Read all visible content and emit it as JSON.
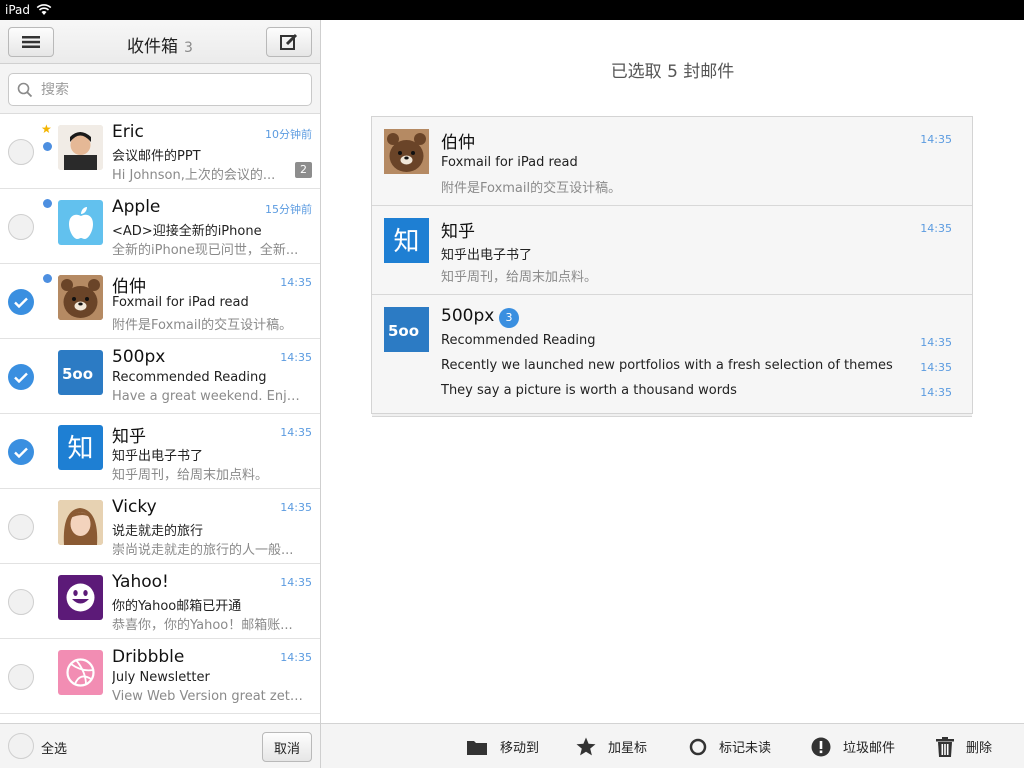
{
  "status_bar": {
    "device": "iPad"
  },
  "inbox": {
    "title": "收件箱",
    "count": "3",
    "search_placeholder": "搜索"
  },
  "messages": [
    {
      "name": "Eric",
      "time": "10分钟前",
      "subject": "会议邮件的PPT",
      "preview": "Hi Johnson,上次的会议的...",
      "badge": "2",
      "starred": true,
      "unread": true,
      "selected": false,
      "avatar": "person-eric"
    },
    {
      "name": "Apple",
      "time": "15分钟前",
      "subject": "<AD>迎接全新的iPhone",
      "preview": "全新的iPhone现已问世，全新...",
      "unread": true,
      "selected": false,
      "avatar": "apple-logo"
    },
    {
      "name": "伯仲",
      "time": "14:35",
      "subject": "Foxmail for iPad read",
      "preview": "附件是Foxmail的交互设计稿。",
      "unread": true,
      "selected": true,
      "avatar": "bear"
    },
    {
      "name": "500px",
      "time": "14:35",
      "subject": "Recommended Reading",
      "preview": "Have a great weekend. Enjoy ...",
      "selected": true,
      "avatar": "500px-logo"
    },
    {
      "name": "知乎",
      "time": "14:35",
      "subject": "知乎出电子书了",
      "preview": "知乎周刊，给周末加点料。",
      "selected": true,
      "avatar": "zhihu-logo"
    },
    {
      "name": "Vicky",
      "time": "14:35",
      "subject": "说走就走的旅行",
      "preview": "崇尚说走就走的旅行的人一般...",
      "selected": false,
      "avatar": "person-vicky"
    },
    {
      "name": "Yahoo!",
      "time": "14:35",
      "subject": "你的Yahoo邮箱已开通",
      "preview": "恭喜你，你的Yahoo！邮箱账...",
      "selected": false,
      "avatar": "yahoo-logo"
    },
    {
      "name": "Dribbble",
      "time": "14:35",
      "subject": "July Newsletter",
      "preview": "View Web Version great zetus...",
      "selected": false,
      "avatar": "dribbble-logo"
    }
  ],
  "left_footer": {
    "select_all": "全选",
    "cancel": "取消"
  },
  "detail": {
    "title": "已选取 5 封邮件",
    "cards": [
      {
        "name": "伯仲",
        "time": "14:35",
        "subject": "Foxmail for iPad read",
        "preview": "附件是Foxmail的交互设计稿。"
      },
      {
        "name": "知乎",
        "time": "14:35",
        "subject": "知乎出电子书了",
        "preview": "知乎周刊，给周末加点料。"
      },
      {
        "name": "500px",
        "badge": "3",
        "lines": [
          {
            "text": "Recommended Reading",
            "time": "14:35"
          },
          {
            "text": "Recently we launched new portfolios with a fresh selection of themes",
            "time": "14:35"
          },
          {
            "text": "They say a picture is worth a thousand words",
            "time": "14:35"
          }
        ]
      }
    ]
  },
  "actions": {
    "move": "移动到",
    "star": "加星标",
    "unread": "标记未读",
    "spam": "垃圾邮件",
    "delete": "删除"
  },
  "colors": {
    "accent": "#3a8fe0",
    "time": "#5b9be0",
    "zhihu": "#1e7fd3",
    "px500": "#2c7bc4",
    "yahoo": "#5c1a78",
    "dribbble": "#f28db3",
    "apple": "#62c1ee"
  }
}
